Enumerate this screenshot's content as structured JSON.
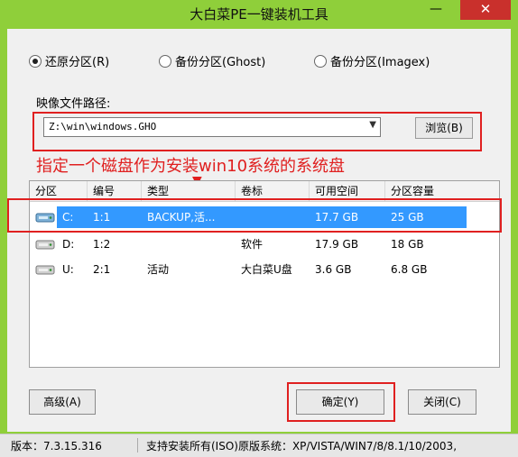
{
  "window": {
    "title": "大白菜PE一键装机工具",
    "minimize": "—",
    "close": "✕"
  },
  "modes": [
    {
      "label": "还原分区(R)",
      "selected": true
    },
    {
      "label": "备份分区(Ghost)",
      "selected": false
    },
    {
      "label": "备份分区(Imagex)",
      "selected": false
    }
  ],
  "image_path": {
    "label": "映像文件路径:",
    "value": "Z:\\win\\windows.GHO",
    "browse": "浏览(B)"
  },
  "annotation": "指定一个磁盘作为安装win10系统的系统盘",
  "table": {
    "headers": [
      "分区",
      "编号",
      "类型",
      "卷标",
      "可用空间",
      "分区容量"
    ],
    "rows": [
      {
        "drive": "C:",
        "num": "1:1",
        "type": "BACKUP,活...",
        "label": "",
        "free": "17.7 GB",
        "size": "25 GB",
        "selected": true
      },
      {
        "drive": "D:",
        "num": "1:2",
        "type": "",
        "label": "软件",
        "free": "17.9 GB",
        "size": "18 GB",
        "selected": false
      },
      {
        "drive": "U:",
        "num": "2:1",
        "type": "活动",
        "label": "大白菜U盘",
        "free": "3.6 GB",
        "size": "6.8 GB",
        "selected": false
      }
    ]
  },
  "buttons": {
    "advanced": "高级(A)",
    "ok": "确定(Y)",
    "close": "关闭(C)"
  },
  "status": {
    "version": "版本：7.3.15.316",
    "support": "支持安装所有(ISO)原版系统：XP/VISTA/WIN7/8/8.1/10/2003,"
  },
  "colors": {
    "frame": "#8fcf3a",
    "highlight": "#3399ff",
    "annotation": "#e02020"
  }
}
